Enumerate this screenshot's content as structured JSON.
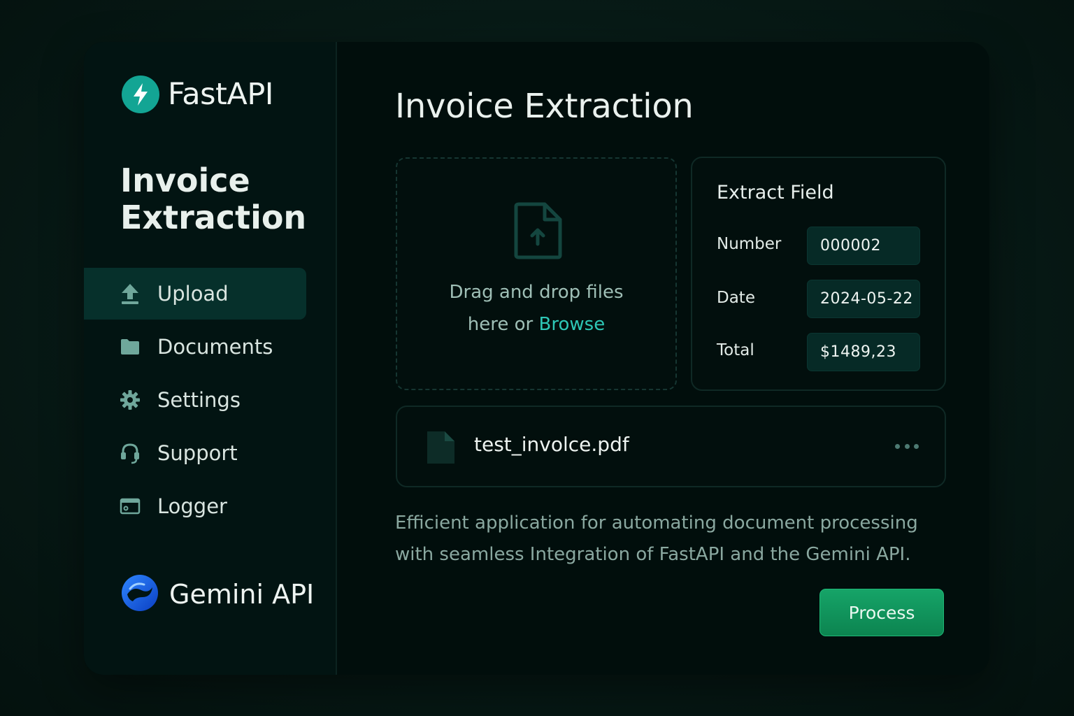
{
  "brand": {
    "name": "FastAPI",
    "icon": "lightning-bolt-icon",
    "accent": "#13a594"
  },
  "sidebar": {
    "title_line1": "Invoice",
    "title_line2": "Extraction",
    "items": [
      {
        "label": "Upload",
        "icon": "upload-icon",
        "active": true
      },
      {
        "label": "Documents",
        "icon": "folder-icon",
        "active": false
      },
      {
        "label": "Settings",
        "icon": "gear-icon",
        "active": false
      },
      {
        "label": "Support",
        "icon": "headset-icon",
        "active": false
      },
      {
        "label": "Logger",
        "icon": "terminal-window-icon",
        "active": false
      }
    ],
    "footer": {
      "name": "Gemini API",
      "icon": "gemini-logo-icon"
    }
  },
  "main": {
    "title": "Invoice Extraction",
    "dropzone": {
      "line1": "Drag and drop files",
      "line2_prefix": "here or ",
      "browse_label": "Browse"
    },
    "extract": {
      "title": "Extract Field",
      "fields": [
        {
          "label": "Number",
          "value": "000002"
        },
        {
          "label": "Date",
          "value": "2024-05-22"
        },
        {
          "label": "Total",
          "value": "$1489,23"
        }
      ]
    },
    "file": {
      "name": "test_involce.pdf"
    },
    "description_line1": "Efficient application for automating document processing",
    "description_line2": "with seamless Integration of FastAPI and the Gemini API.",
    "process_label": "Process"
  },
  "colors": {
    "accent_teal": "#2ec7b6",
    "process_green": "#16a468",
    "active_nav": "#06302b"
  }
}
